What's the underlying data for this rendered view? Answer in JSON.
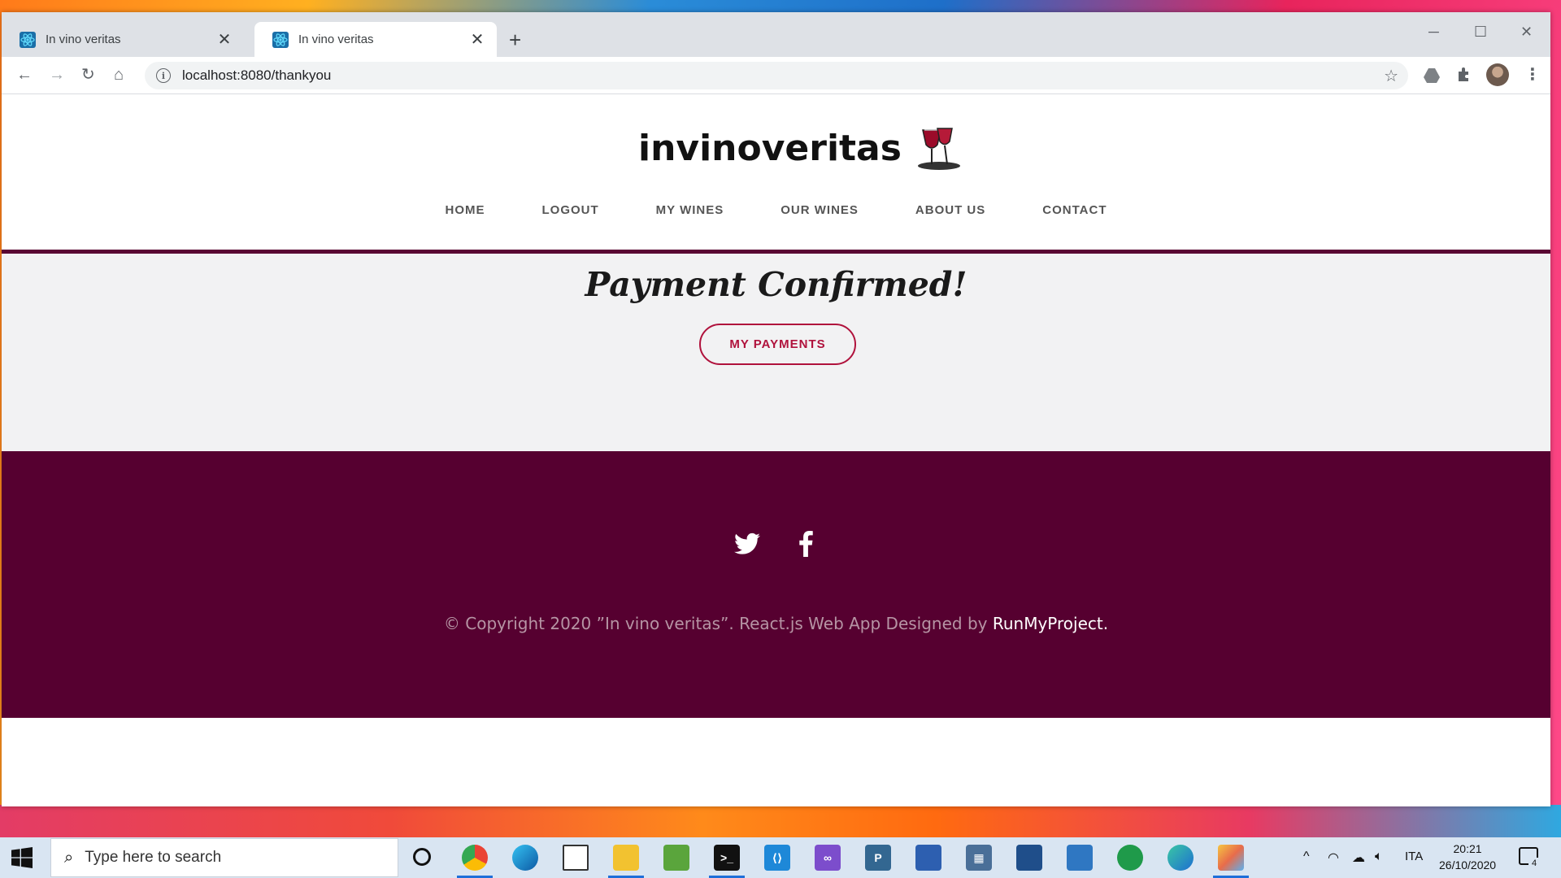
{
  "browser": {
    "tabs": [
      {
        "title": "In vino veritas",
        "active": false
      },
      {
        "title": "In vino veritas",
        "active": true
      }
    ],
    "new_tab_glyph": "+",
    "close_glyph": "✕",
    "url": "localhost:8080/thankyou",
    "icons": [
      "back-arrow-icon",
      "forward-arrow-icon",
      "reload-icon",
      "home-icon",
      "info-icon",
      "star-icon",
      "drive-icon",
      "extensions-icon",
      "profile-avatar",
      "menu-icon"
    ]
  },
  "site": {
    "logo_text": "invinoveritas",
    "nav": [
      "HOME",
      "LOGOUT",
      "MY WINES",
      "OUR WINES",
      "ABOUT US",
      "CONTACT"
    ],
    "headline": "Payment Confirmed!",
    "payments_button": "MY PAYMENTS",
    "social": [
      "twitter-icon",
      "facebook-icon"
    ],
    "copyright_prefix": "© Copyright 2020 ”In vino veritas”. React.js Web App Designed by ",
    "copyright_brand": "RunMyProject.",
    "colors": {
      "brand_wine": "#560030",
      "accent_red": "#b0123c",
      "content_bg": "#f2f2f3"
    }
  },
  "taskbar": {
    "search_placeholder": "Type here to search",
    "language": "ITA",
    "time": "20:21",
    "date": "26/10/2020",
    "notification_count": "4"
  }
}
